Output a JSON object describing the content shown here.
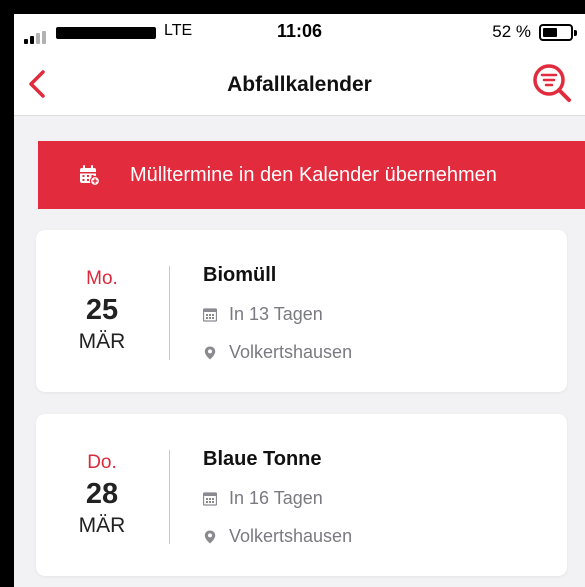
{
  "status_bar": {
    "network": "LTE",
    "time": "11:06",
    "battery": "52 %",
    "battery_level": 0.52
  },
  "nav": {
    "title": "Abfallkalender"
  },
  "banner": {
    "label": "Mülltermine in den Kalender übernehmen"
  },
  "colors": {
    "accent": "#e22b3d",
    "background": "#f2f2f4",
    "card": "#ffffff",
    "muted_text": "#7a7a80"
  },
  "events": [
    {
      "weekday": "Mo.",
      "day": "25",
      "month": "MÄR",
      "type": "Biomüll",
      "days_until": "In 13 Tagen",
      "location": "Volkertshausen"
    },
    {
      "weekday": "Do.",
      "day": "28",
      "month": "MÄR",
      "type": "Blaue Tonne",
      "days_until": "In 16 Tagen",
      "location": "Volkertshausen"
    }
  ]
}
